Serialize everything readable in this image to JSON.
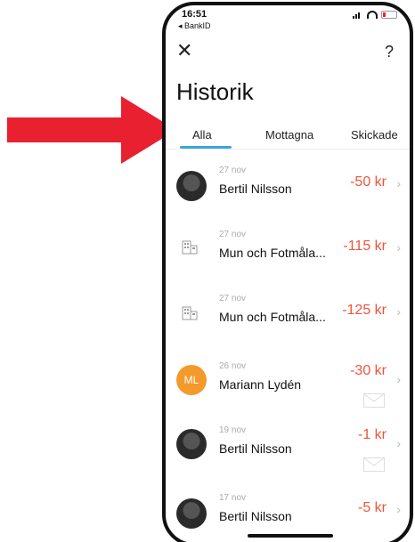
{
  "status": {
    "time": "16:51",
    "back_app": "◂ BankID"
  },
  "header": {
    "close_label": "✕",
    "help_label": "?",
    "title": "Historik"
  },
  "tabs": [
    {
      "label": "Alla",
      "active": true
    },
    {
      "label": "Mottagna",
      "active": false
    },
    {
      "label": "Skickade",
      "active": false
    }
  ],
  "transactions": [
    {
      "date": "27 nov",
      "name": "Bertil Nilsson",
      "amount": "-50 kr",
      "avatar": "photo"
    },
    {
      "date": "27 nov",
      "name": "Mun och Fotmåla...",
      "amount": "-115 kr",
      "avatar": "building-icon"
    },
    {
      "date": "27 nov",
      "name": "Mun och Fotmåla...",
      "amount": "-125 kr",
      "avatar": "building-icon"
    },
    {
      "date": "26 nov",
      "name": "Mariann Lydén",
      "amount": "-30 kr",
      "avatar": "initials",
      "initials": "ML",
      "message": true
    },
    {
      "date": "19 nov",
      "name": "Bertil Nilsson",
      "amount": "-1 kr",
      "avatar": "photo",
      "message": true
    },
    {
      "date": "17 nov",
      "name": "Bertil Nilsson",
      "amount": "-5 kr",
      "avatar": "photo"
    }
  ],
  "colors": {
    "accent": "#3aa6d8",
    "amount": "#f0543a",
    "arrow": "#e8202f",
    "initials_bg": "#f39a2a"
  }
}
